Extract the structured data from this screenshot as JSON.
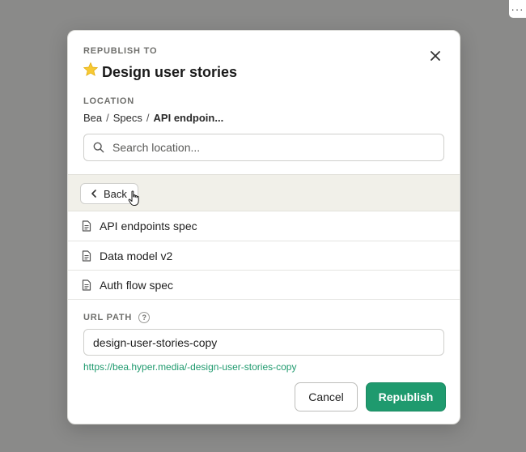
{
  "corner_menu": {
    "label": "···"
  },
  "dialog": {
    "heading_label": "REPUBLISH TO",
    "title": "Design user stories",
    "title_icon": "star-icon",
    "location_label": "LOCATION",
    "breadcrumb": [
      "Bea",
      "Specs",
      "API endpoin..."
    ],
    "breadcrumb_sep": "/",
    "search": {
      "placeholder": "Search location...",
      "value": ""
    },
    "back_label": "Back",
    "items": [
      {
        "label": "API endpoints spec"
      },
      {
        "label": "Data model v2"
      },
      {
        "label": "Auth flow spec"
      }
    ],
    "url_label": "URL PATH",
    "url_help": "?",
    "url_value": "design-user-stories-copy",
    "url_preview": "https://bea.hyper.media/-design-user-stories-copy",
    "cancel_label": "Cancel",
    "republish_label": "Republish"
  },
  "colors": {
    "accent": "#1f9a6e",
    "overlay": "#8a8a89",
    "nav_band": "#f1f0e9"
  }
}
